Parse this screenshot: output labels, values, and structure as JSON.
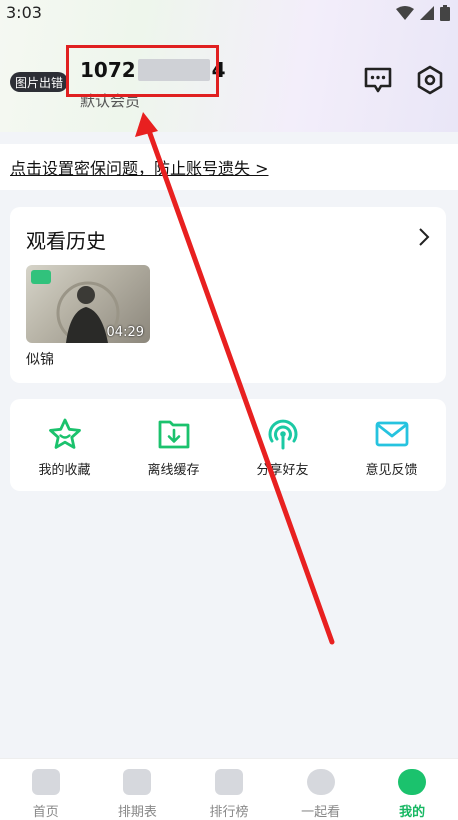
{
  "status_bar": {
    "time": "3:03"
  },
  "profile": {
    "avatar_text": "图片出错",
    "user_id_prefix": "1072",
    "user_id_suffix": "4",
    "member_level": "默认会员"
  },
  "security": {
    "text": "点击设置密保问题，防止账号遗失 >"
  },
  "history": {
    "title": "观看历史",
    "items": [
      {
        "title": "似锦",
        "duration": "04:29"
      }
    ]
  },
  "actions": [
    {
      "label": "我的收藏",
      "icon": "star-icon"
    },
    {
      "label": "离线缓存",
      "icon": "download-folder-icon"
    },
    {
      "label": "分享好友",
      "icon": "share-signal-icon"
    },
    {
      "label": "意见反馈",
      "icon": "mail-icon"
    }
  ],
  "tabs": [
    {
      "label": "首页",
      "icon": "home-icon",
      "active": false
    },
    {
      "label": "排期表",
      "icon": "calendar-icon",
      "active": false
    },
    {
      "label": "排行榜",
      "icon": "ranking-icon",
      "active": false
    },
    {
      "label": "一起看",
      "icon": "watch-together-icon",
      "active": false
    },
    {
      "label": "我的",
      "icon": "profile-icon",
      "active": true
    }
  ],
  "colors": {
    "accent": "#1bc26d",
    "highlight": "#e02020",
    "background": "#f2f4f8"
  }
}
